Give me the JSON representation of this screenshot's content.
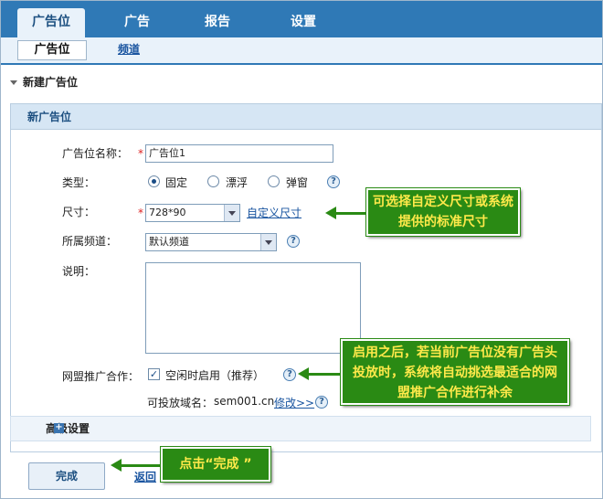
{
  "nav": {
    "tabs": [
      "广告位",
      "广告",
      "报告",
      "设置"
    ],
    "subtabs": [
      "广告位",
      "频道"
    ]
  },
  "section": {
    "title": "新建广告位"
  },
  "panel": {
    "title": "新广告位"
  },
  "form": {
    "name_label": "广告位名称：",
    "name_value": "广告位1",
    "type_label": "类型：",
    "type_options": [
      "固定",
      "漂浮",
      "弹窗"
    ],
    "size_label": "尺寸：",
    "size_value": "728*90",
    "size_custom_link": "自定义尺寸",
    "channel_label": "所属频道：",
    "channel_value": "默认频道",
    "desc_label": "说明：",
    "union_label": "网盟推广合作：",
    "union_checkbox_label": "空闲时启用（推荐）",
    "domain_label": "可投放域名：",
    "domain_value": "sem001.cn",
    "domain_edit_link": "修改>>",
    "advanced": "高级设置",
    "required_mark": "*",
    "help_mark": "?"
  },
  "footer": {
    "done_button": "完成",
    "back_link": "返回"
  },
  "callouts": {
    "size": "可选择自定义尺寸或系统提供的标准尺寸",
    "union": "启用之后，若当前广告位没有广告头投放时，系统将自动挑选最适合的网盟推广合作进行补余",
    "done": "点击“完成 ”"
  },
  "colors": {
    "nav_bg": "#2f79b6",
    "callout_bg": "#2a8a14",
    "callout_text": "#ffe94a"
  }
}
